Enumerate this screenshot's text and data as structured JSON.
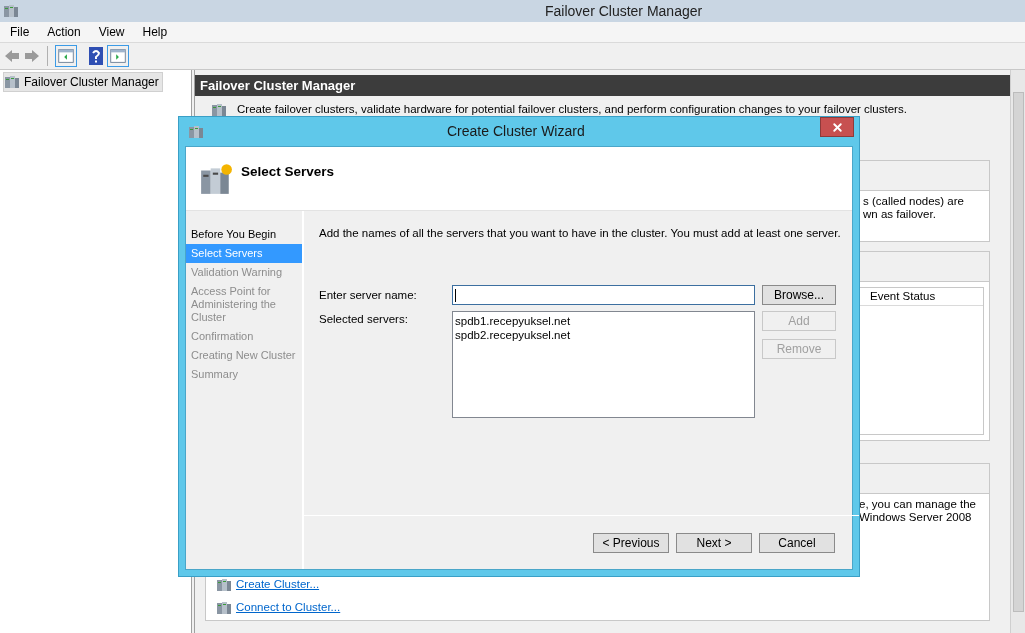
{
  "window": {
    "title": "Failover Cluster Manager"
  },
  "menu": [
    "File",
    "Action",
    "View",
    "Help"
  ],
  "tree": {
    "items": [
      {
        "label": "Failover Cluster Manager",
        "selected": true
      }
    ]
  },
  "pane": {
    "title": "Failover Cluster Manager",
    "description": "Create failover clusters, validate hardware for potential failover clusters, and perform configuration changes to your failover clusters.",
    "section_1_text": [
      "s (called nodes) are",
      "wn as failover."
    ],
    "section_2_column": "Event Status",
    "section_3_text": [
      "e, you can manage the",
      "Windows Server 2008"
    ],
    "links": [
      "Create Cluster...",
      "Connect to Cluster..."
    ]
  },
  "dialog": {
    "title": "Create Cluster Wizard",
    "heading": "Select Servers",
    "steps": [
      {
        "label": "Before You Begin",
        "selected": false,
        "disabled": false
      },
      {
        "label": "Select Servers",
        "selected": true,
        "disabled": false
      },
      {
        "label": "Validation Warning",
        "selected": false,
        "disabled": true
      },
      {
        "label": "Access Point for Administering the Cluster",
        "selected": false,
        "disabled": true
      },
      {
        "label": "Confirmation",
        "selected": false,
        "disabled": true
      },
      {
        "label": "Creating New Cluster",
        "selected": false,
        "disabled": true
      },
      {
        "label": "Summary",
        "selected": false,
        "disabled": true
      }
    ],
    "instruction": "Add the names of all the servers that you want to have in the cluster. You must add at least one server.",
    "server_name_label": "Enter server name:",
    "selected_servers": {
      "label": "Selected servers:",
      "items": [
        "spdb1.recepyuksel.net",
        "spdb2.recepyuksel.net"
      ]
    },
    "side_buttons": [
      {
        "label": "Browse...",
        "disabled": false
      },
      {
        "label": "Add",
        "disabled": true
      },
      {
        "label": "Remove",
        "disabled": true
      }
    ],
    "footer_buttons": [
      {
        "label": "< Previous",
        "disabled": false
      },
      {
        "label": "Next >",
        "disabled": false
      },
      {
        "label": "Cancel",
        "disabled": false
      }
    ]
  }
}
